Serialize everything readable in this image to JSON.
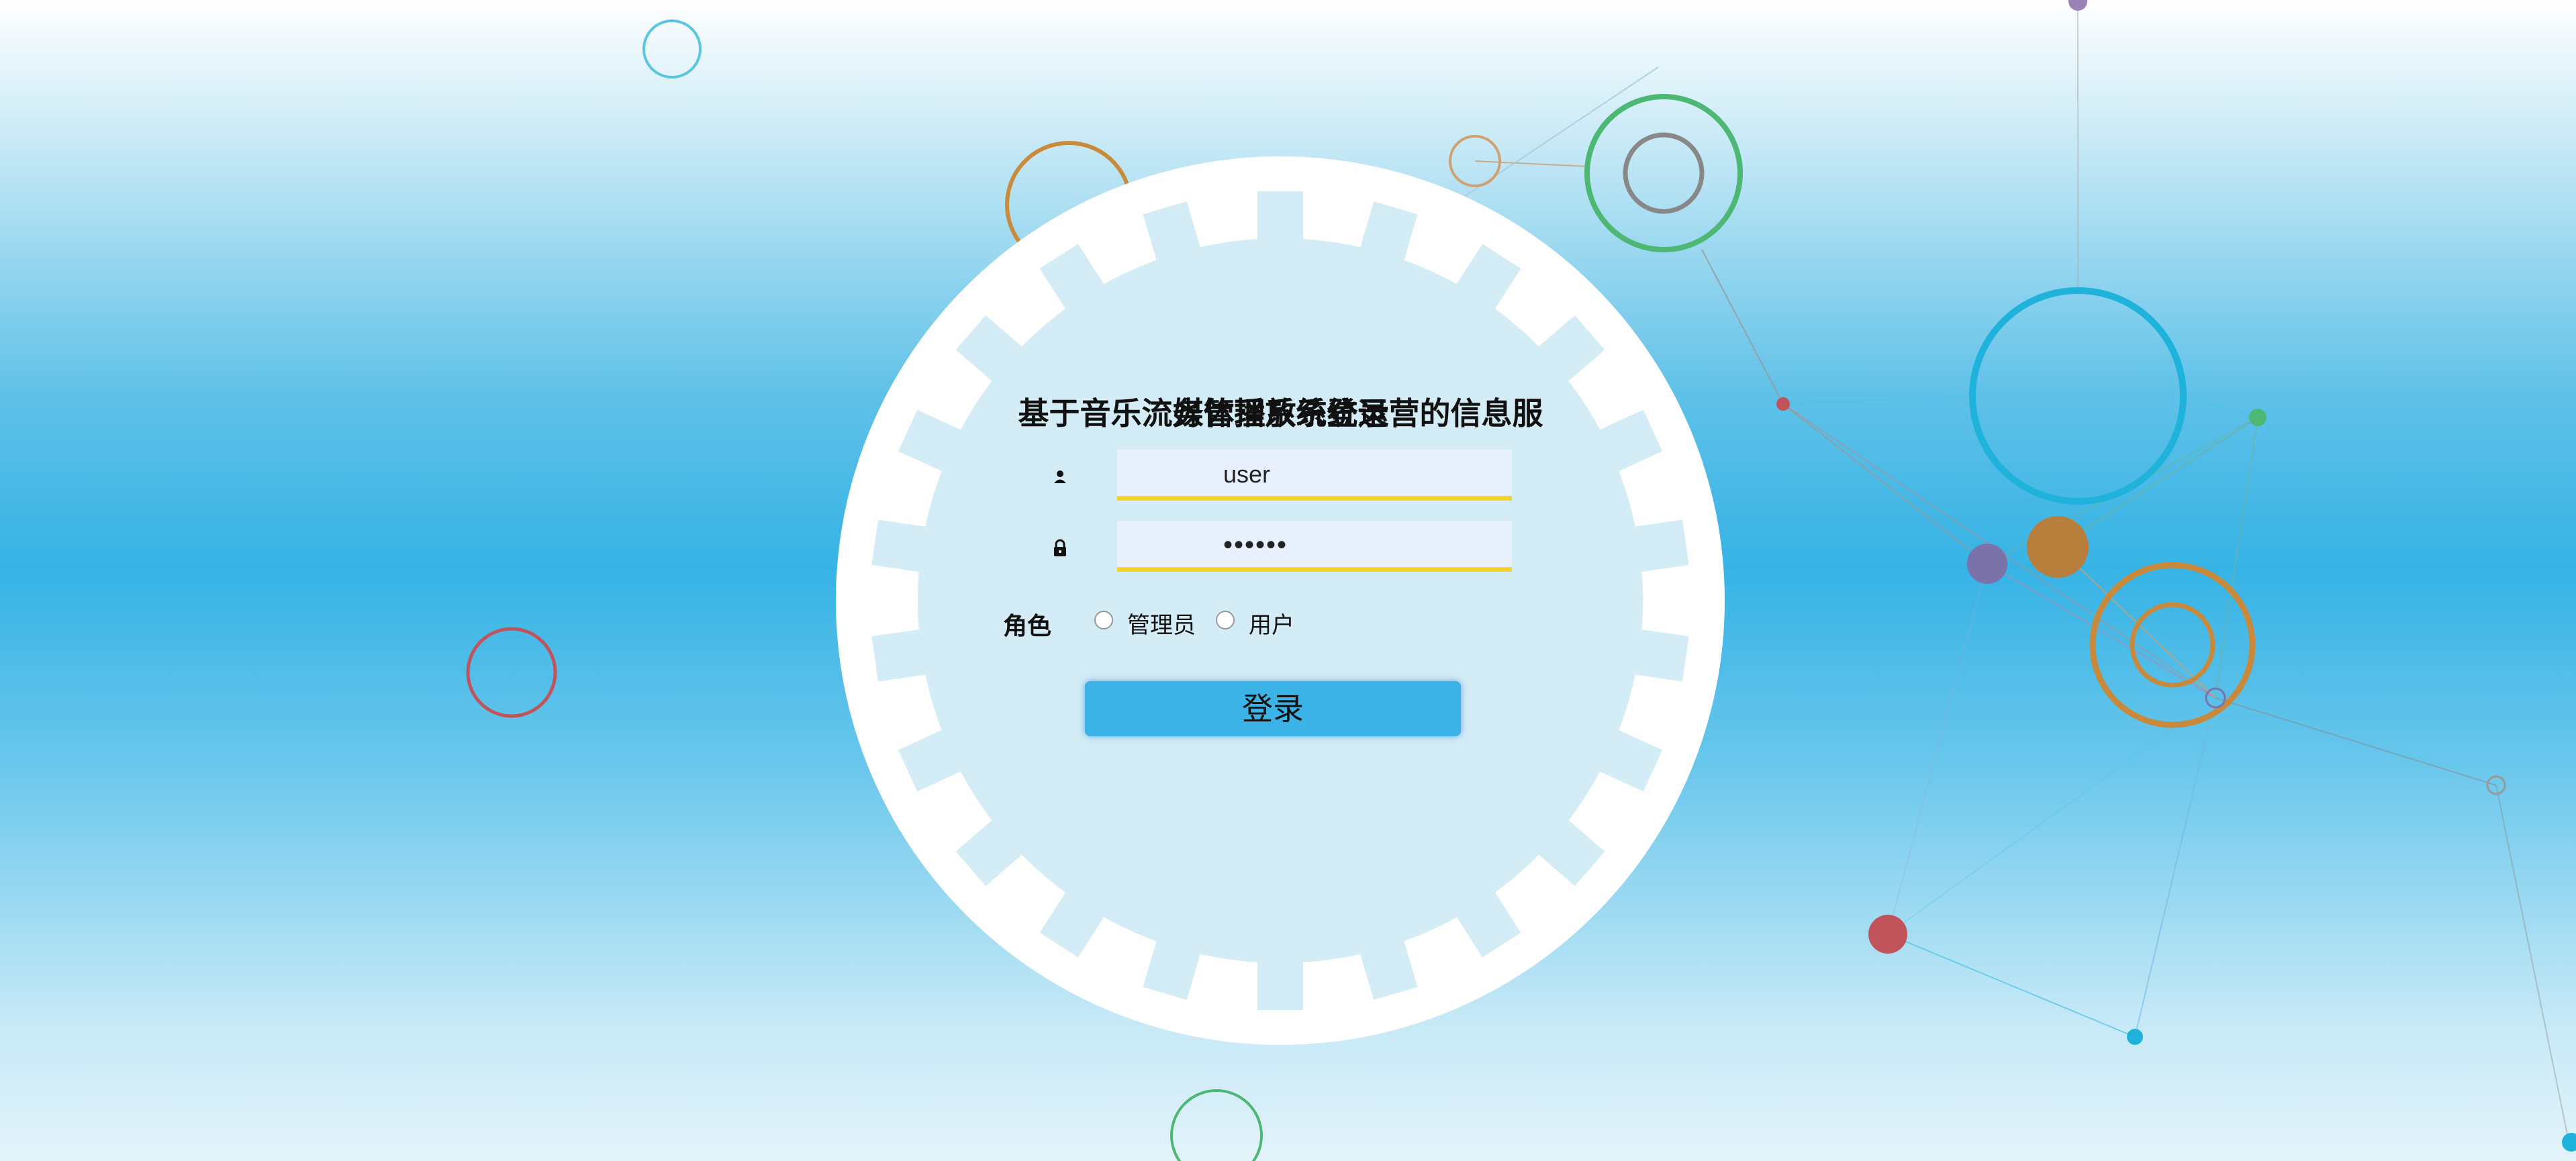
{
  "page": {
    "title_line_a": "基于音乐流媒体播放系统运营的信息服",
    "title_line_b": "务管理系统登录"
  },
  "login": {
    "username_value": "user",
    "password_value": "••••••",
    "role_label": "角色",
    "role_options": [
      "管理员",
      "用户"
    ],
    "submit_label": "登录"
  },
  "icons": {
    "username": "user-icon",
    "password": "lock-icon"
  },
  "colors": {
    "background_accent": "#36b3e5",
    "input_background": "#e8f0fe",
    "input_underline": "#f5d226",
    "button": "#3bb3e6",
    "panel": "#d3ecf6"
  }
}
